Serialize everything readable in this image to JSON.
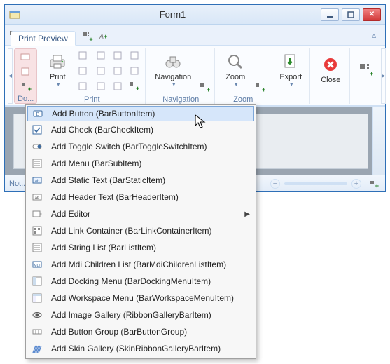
{
  "window": {
    "title": "Form1"
  },
  "quick": {
    "tab_label": "Print Preview"
  },
  "ribbon": {
    "file_label": "Do...",
    "print_label": "Print",
    "nav_label": "Navigation",
    "zoom_label": "Zoom",
    "export_label": "Export",
    "close_label": "Close"
  },
  "status": {
    "left": "Not..."
  },
  "menu": {
    "items": [
      {
        "icon": "button-icon",
        "label": "Add Button (BarButtonItem)",
        "arrow": false,
        "hover": true
      },
      {
        "icon": "check-icon",
        "label": "Add Check (BarCheckItem)",
        "arrow": false,
        "hover": false
      },
      {
        "icon": "toggle-icon",
        "label": "Add Toggle Switch (BarToggleSwitchItem)",
        "arrow": false,
        "hover": false
      },
      {
        "icon": "menu-icon",
        "label": "Add Menu (BarSubItem)",
        "arrow": false,
        "hover": false
      },
      {
        "icon": "static-text-icon",
        "label": "Add Static Text (BarStaticItem)",
        "arrow": false,
        "hover": false
      },
      {
        "icon": "header-text-icon",
        "label": "Add Header Text (BarHeaderItem)",
        "arrow": false,
        "hover": false
      },
      {
        "icon": "editor-icon",
        "label": "Add Editor",
        "arrow": true,
        "hover": false
      },
      {
        "icon": "link-container-icon",
        "label": "Add Link Container (BarLinkContainerItem)",
        "arrow": false,
        "hover": false
      },
      {
        "icon": "string-list-icon",
        "label": "Add String List (BarListItem)",
        "arrow": false,
        "hover": false
      },
      {
        "icon": "mdi-icon",
        "label": "Add Mdi Children List (BarMdiChildrenListItem)",
        "arrow": false,
        "hover": false
      },
      {
        "icon": "docking-icon",
        "label": "Add Docking Menu (BarDockingMenuItem)",
        "arrow": false,
        "hover": false
      },
      {
        "icon": "workspace-icon",
        "label": "Add Workspace Menu (BarWorkspaceMenuItem)",
        "arrow": false,
        "hover": false
      },
      {
        "icon": "gallery-icon",
        "label": "Add Image Gallery (RibbonGalleryBarItem)",
        "arrow": false,
        "hover": false
      },
      {
        "icon": "button-group-icon",
        "label": "Add Button Group (BarButtonGroup)",
        "arrow": false,
        "hover": false
      },
      {
        "icon": "skin-gallery-icon",
        "label": "Add Skin Gallery (SkinRibbonGalleryBarItem)",
        "arrow": false,
        "hover": false
      }
    ]
  }
}
